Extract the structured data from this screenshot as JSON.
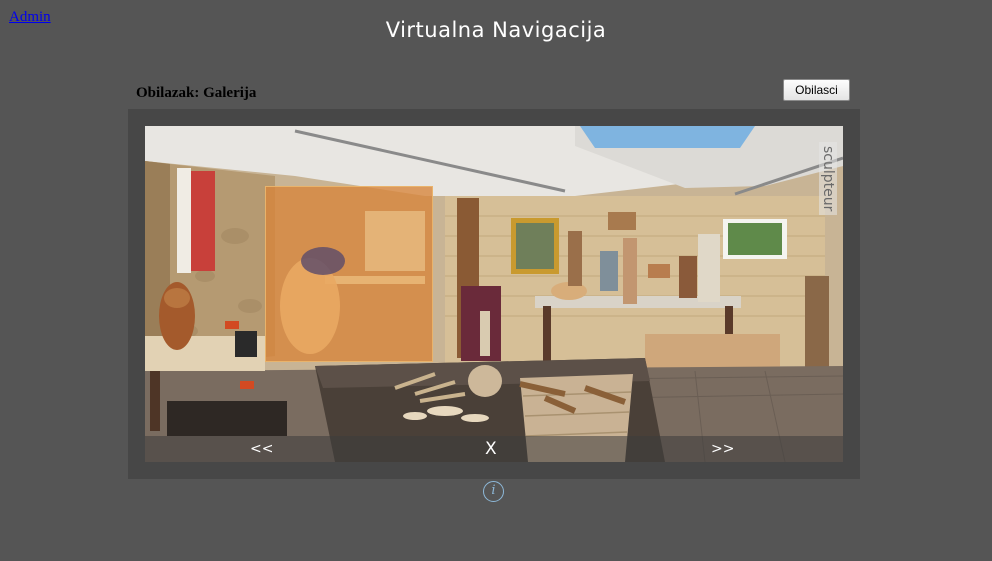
{
  "header": {
    "admin_link": "Admin",
    "title": "Virtualna Navigacija"
  },
  "tour": {
    "label": "Obilazak: Galerija",
    "tours_button": "Obilasci"
  },
  "viewer": {
    "side_brand": "sculpteur",
    "nav": {
      "prev_label": "<<",
      "close_label": "X",
      "next_label": ">>"
    }
  },
  "footer": {
    "info_icon_glyph": "i"
  }
}
